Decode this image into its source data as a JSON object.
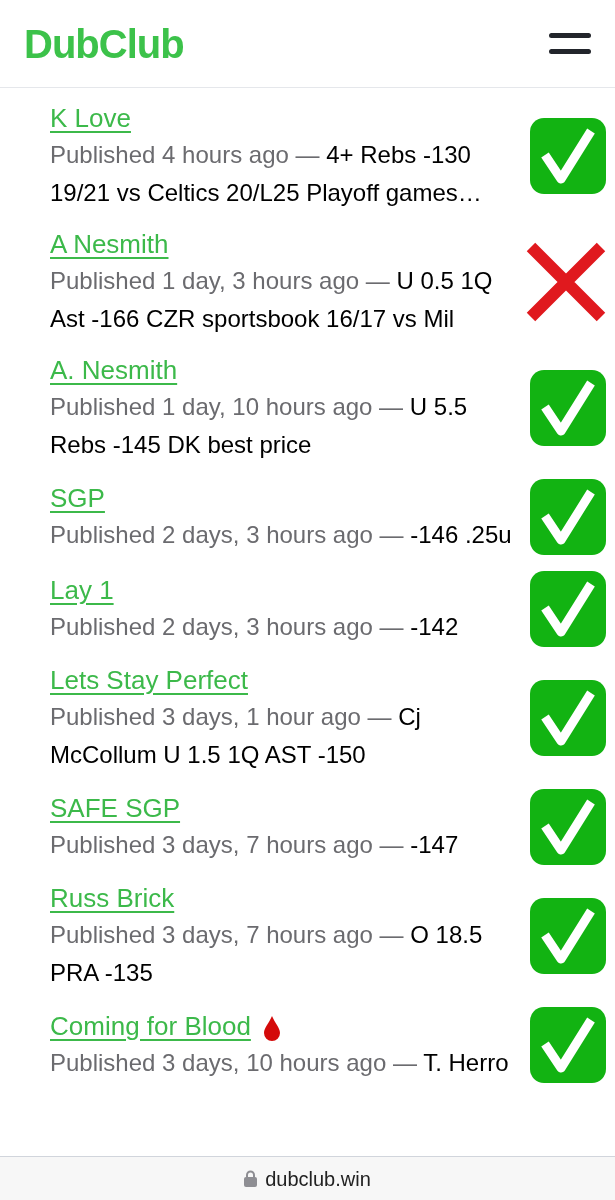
{
  "header": {
    "logo": "DubClub"
  },
  "picks": [
    {
      "title": "K Love",
      "drop": false,
      "published": "Published 4 hours ago — ",
      "description": "4+ Rebs -130 19/21 vs Celtics 20/L25 Playoff games…",
      "kind": "win"
    },
    {
      "title": "A Nesmith",
      "drop": false,
      "published": "Published 1 day, 3 hours ago — ",
      "description": "U 0.5 1Q Ast -166 CZR sportsbook 16/17 vs Mil",
      "kind": "loss"
    },
    {
      "title": "A. Nesmith",
      "drop": false,
      "published": "Published 1 day, 10 hours ago — ",
      "description": "U 5.5 Rebs -145 DK best price",
      "kind": "win"
    },
    {
      "title": "SGP",
      "drop": false,
      "published": "Published 2 days, 3 hours ago — ",
      "description": "-146 .25u",
      "kind": "win"
    },
    {
      "title": "Lay 1",
      "drop": false,
      "published": "Published 2 days, 3 hours ago — ",
      "description": "-142",
      "kind": "win"
    },
    {
      "title": "Lets Stay Perfect",
      "drop": false,
      "published": "Published 3 days, 1 hour ago — ",
      "description": "Cj McCollum U 1.5 1Q AST -150",
      "kind": "win"
    },
    {
      "title": "SAFE SGP",
      "drop": false,
      "published": "Published 3 days, 7 hours ago — ",
      "description": "-147",
      "kind": "win"
    },
    {
      "title": "Russ Brick",
      "drop": false,
      "published": "Published 3 days, 7 hours ago — ",
      "description": "O 18.5 PRA -135",
      "kind": "win"
    },
    {
      "title": "Coming for Blood",
      "drop": true,
      "published": "Published 3 days, 10 hours ago — ",
      "description": "T. Herro",
      "kind": "win"
    }
  ],
  "footer": {
    "url": "dubclub.win"
  }
}
